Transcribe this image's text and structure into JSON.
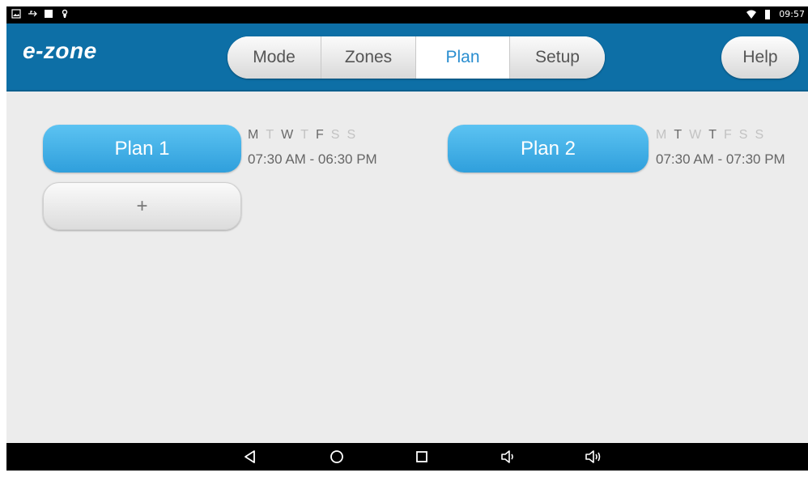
{
  "status_bar": {
    "time": "09:57",
    "left_icons": [
      "gallery-icon",
      "usb-icon",
      "square-icon",
      "debug-icon"
    ],
    "right_icons": [
      "wifi-icon",
      "battery-icon"
    ]
  },
  "header": {
    "logo": "e-zone",
    "tabs": [
      {
        "label": "Mode",
        "active": false
      },
      {
        "label": "Zones",
        "active": false
      },
      {
        "label": "Plan",
        "active": true
      },
      {
        "label": "Setup",
        "active": false
      }
    ],
    "help_label": "Help"
  },
  "plans": [
    {
      "label": "Plan 1",
      "days": [
        {
          "letter": "M",
          "on": true
        },
        {
          "letter": "T",
          "on": false
        },
        {
          "letter": "W",
          "on": true
        },
        {
          "letter": "T",
          "on": false
        },
        {
          "letter": "F",
          "on": true
        },
        {
          "letter": "S",
          "on": false
        },
        {
          "letter": "S",
          "on": false
        }
      ],
      "hours": "07:30 AM - 06:30 PM"
    },
    {
      "label": "Plan 2",
      "days": [
        {
          "letter": "M",
          "on": false
        },
        {
          "letter": "T",
          "on": true
        },
        {
          "letter": "W",
          "on": false
        },
        {
          "letter": "T",
          "on": true
        },
        {
          "letter": "F",
          "on": false
        },
        {
          "letter": "S",
          "on": false
        },
        {
          "letter": "S",
          "on": false
        }
      ],
      "hours": "07:30 AM - 07:30 PM"
    }
  ],
  "add_plan_label": "+",
  "nav_bar": {
    "icons": [
      "back-icon",
      "home-icon",
      "recents-icon",
      "volume-down-icon",
      "volume-up-icon"
    ]
  },
  "colors": {
    "header": "#0d6fa6",
    "plan_button": "#3aaae3",
    "active_tab_text": "#2a8ed0",
    "background": "#ececec"
  }
}
